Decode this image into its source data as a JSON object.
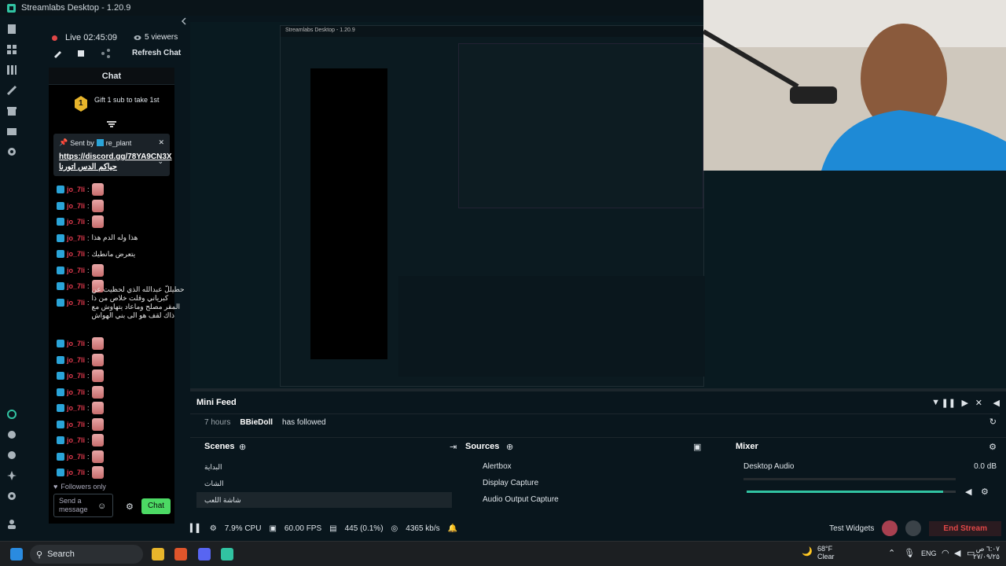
{
  "window": {
    "title": "Streamlabs Desktop - 1.20.9"
  },
  "status": {
    "live": "Live 02:45:09",
    "viewers": "5 viewers",
    "refresh": "Refresh Chat"
  },
  "chat": {
    "header": "Chat",
    "gift": "Gift 1 sub to take 1st",
    "gift_num": "1",
    "pinned": {
      "sent_by": "Sent by",
      "user": "re_plant",
      "link": "https://discord.gg/78YA9CN3X",
      "link_suffix": "حياكم الدس اتورنا"
    },
    "username": "jo_7li",
    "messages": [
      {
        "text": ""
      },
      {
        "text": ""
      },
      {
        "text": ""
      },
      {
        "text": "هذا وله الدم هذا"
      },
      {
        "text": "يتعرض مانطيك"
      },
      {
        "text": ""
      },
      {
        "text": ""
      },
      {
        "text": "حطيللّ عبدالله الذي لحظيت عن كبرياني وقلت خلاص من ذا المقر مصلح وماعاد يتهاوش مع ذاك لقف هو الى بني الهواش"
      },
      {
        "text": ""
      },
      {
        "text": ""
      },
      {
        "text": ""
      },
      {
        "text": ""
      },
      {
        "text": ""
      },
      {
        "text": ""
      },
      {
        "text": ""
      },
      {
        "text": ""
      },
      {
        "text": ""
      }
    ],
    "followers_only": "Followers only",
    "send_placeholder": "Send a message",
    "chat_button": "Chat"
  },
  "minifeed": {
    "title": "Mini Feed",
    "time": "7 hours",
    "user": "BBieDoll",
    "action": "has followed"
  },
  "scenes": {
    "title": "Scenes",
    "items": [
      "البداية",
      "الشات",
      "شاشة اللعب"
    ]
  },
  "sources": {
    "title": "Sources",
    "items": [
      "Alertbox",
      "Display Capture",
      "Audio Output Capture"
    ]
  },
  "mixer": {
    "title": "Mixer",
    "channel": "Desktop Audio",
    "level": "0.0 dB",
    "volume_fraction": 0.94
  },
  "statusbar": {
    "cpu": "7.9% CPU",
    "fps": "60.00 FPS",
    "dropped": "445 (0.1%)",
    "bitrate": "4365 kb/s",
    "test_widgets": "Test Widgets",
    "end_stream": "End Stream"
  },
  "taskbar": {
    "search": "Search",
    "weather_temp": "68°F",
    "weather_cond": "Clear",
    "lang": "ENG",
    "time": "٦:٠٧ ص",
    "date": "٢٧/٠٩/٢٥"
  },
  "colors": {
    "accent": "#31c3a2",
    "live": "#e04747",
    "end_stream": "#e04747",
    "username": "#e53a4e"
  }
}
